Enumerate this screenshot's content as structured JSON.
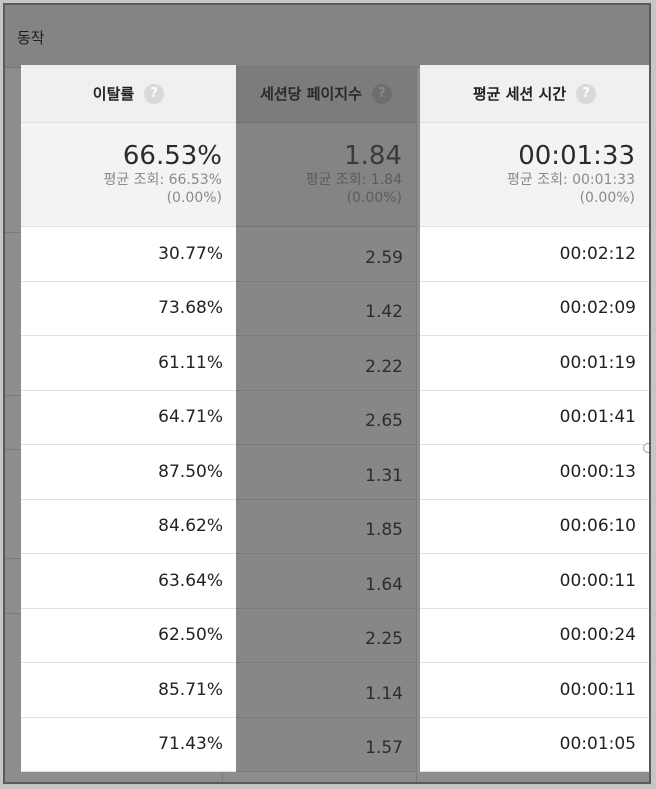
{
  "section": {
    "title": "동작"
  },
  "columns": [
    {
      "header": "이탈률",
      "summary_value": "66.53%",
      "summary_avg": "평균 조회: 66.53%",
      "summary_pct": "(0.00%)",
      "rows": [
        "30.77%",
        "73.68%",
        "61.11%",
        "64.71%",
        "87.50%",
        "84.62%",
        "63.64%",
        "62.50%",
        "85.71%",
        "71.43%"
      ]
    },
    {
      "header": "세션당 페이지수",
      "summary_value": "1.84",
      "summary_avg": "평균 조회: 1.84",
      "summary_pct": "(0.00%)",
      "rows": [
        "2.59",
        "1.42",
        "2.22",
        "2.65",
        "1.31",
        "1.85",
        "1.64",
        "2.25",
        "1.14",
        "1.57"
      ]
    },
    {
      "header": "평균 세션 시간",
      "summary_value": "00:01:33",
      "summary_avg": "평균 조회: 00:01:33",
      "summary_pct": "(0.00%)",
      "rows": [
        "00:02:12",
        "00:02:09",
        "00:01:19",
        "00:01:41",
        "00:00:13",
        "00:06:10",
        "00:00:11",
        "00:00:24",
        "00:00:11",
        "00:01:05"
      ]
    }
  ],
  "icons": {
    "help": "help-circle-icon"
  },
  "colors": {
    "overlay": "#8d8d8d",
    "highlight": "#ffffff"
  }
}
